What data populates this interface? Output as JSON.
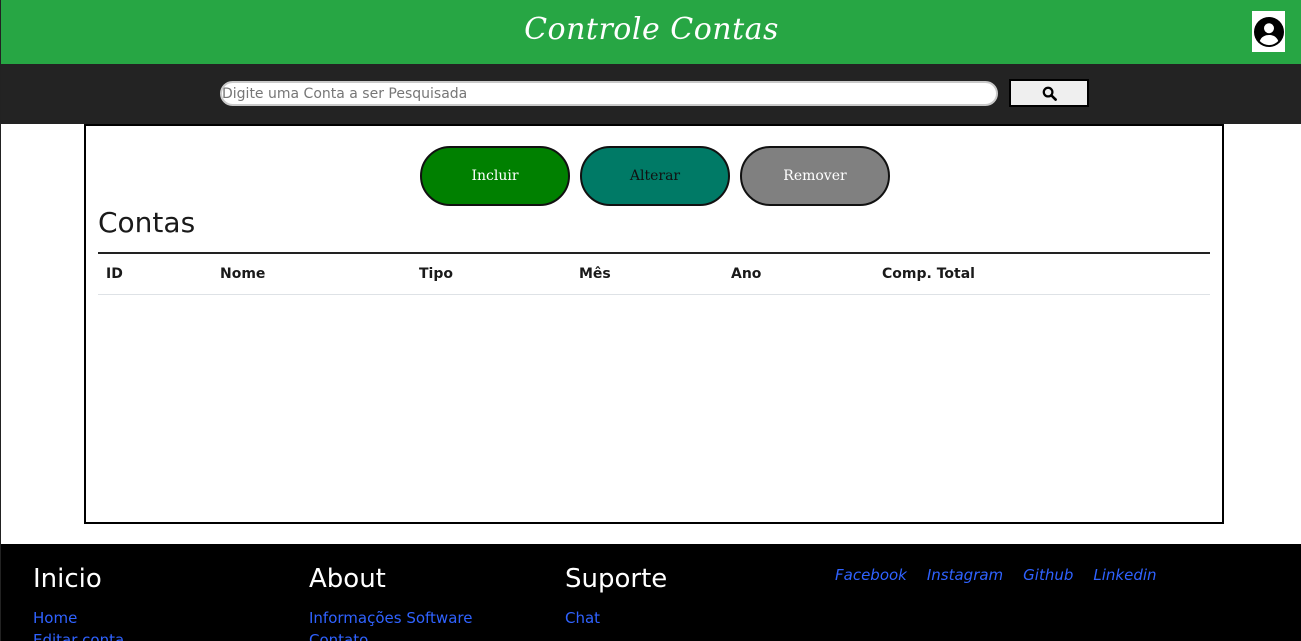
{
  "header": {
    "title": "Controle Contas",
    "avatar_icon": "user-circle-icon"
  },
  "search": {
    "placeholder": "Digite uma Conta a ser Pesquisada",
    "value": "",
    "button_icon": "search-icon"
  },
  "actions": {
    "incluir": "Incluir",
    "alterar": "Alterar",
    "remover": "Remover"
  },
  "main": {
    "title": "Contas",
    "columns": [
      "ID",
      "Nome",
      "Tipo",
      "Mês",
      "Ano",
      "Comp. Total"
    ],
    "rows": []
  },
  "footer": {
    "inicio": {
      "title": "Inicio",
      "links": [
        "Home",
        "Editar conta"
      ]
    },
    "about": {
      "title": "About",
      "links": [
        "Informações Software",
        "Contato"
      ]
    },
    "suporte": {
      "title": "Suporte",
      "links": [
        "Chat"
      ]
    },
    "social": [
      "Facebook",
      "Instagram",
      "Github",
      "Linkedin"
    ]
  },
  "colors": {
    "header": "#27a644",
    "searchbar": "#232323",
    "incluir": "#008000",
    "alterar": "#007a66",
    "remover": "#808080",
    "link": "#2f62ff"
  }
}
